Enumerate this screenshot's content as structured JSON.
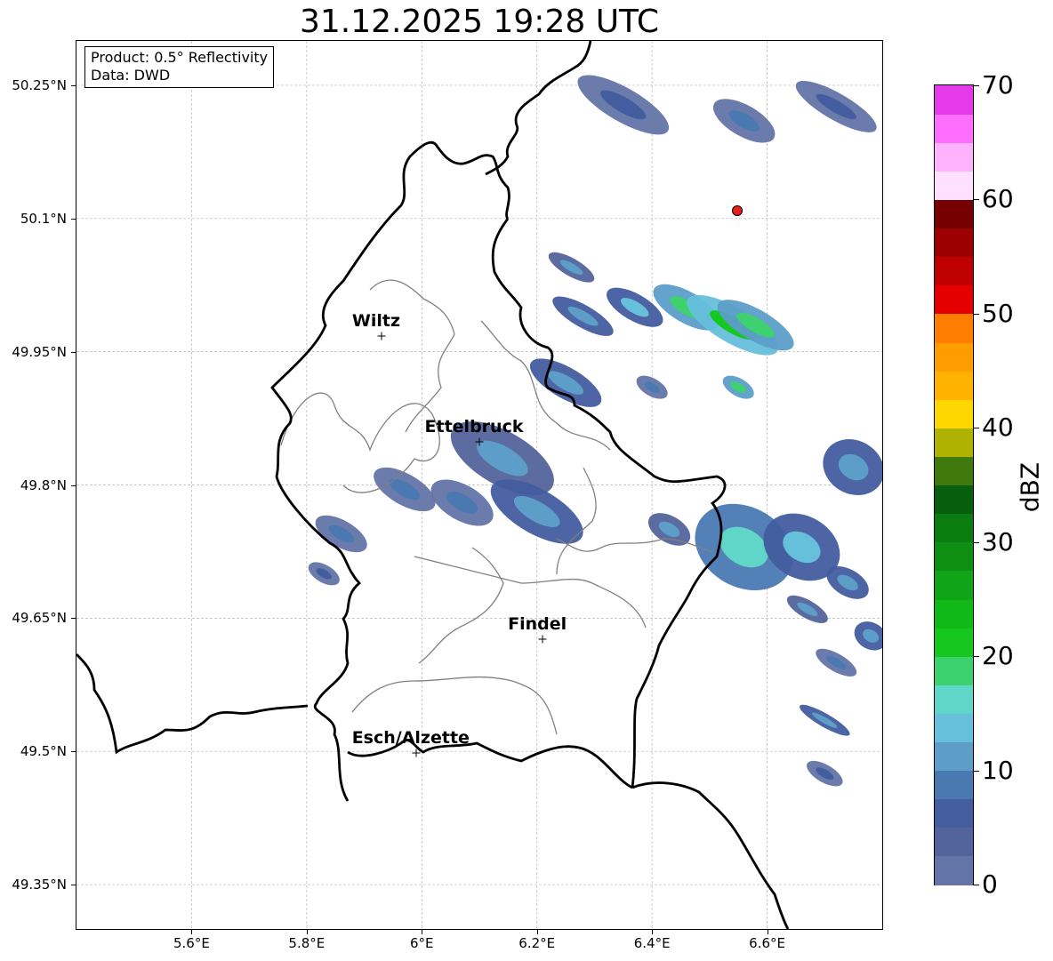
{
  "title": "31.12.2025 19:28 UTC",
  "info_box": {
    "line1": "Product: 0.5° Reflectivity",
    "line2": "Data: DWD"
  },
  "map": {
    "lon_range": [
      5.4,
      6.8
    ],
    "lat_range": [
      49.3,
      50.3
    ],
    "x_ticks": [
      {
        "value": 5.6,
        "label": "5.6°E"
      },
      {
        "value": 5.8,
        "label": "5.8°E"
      },
      {
        "value": 6.0,
        "label": "6°E"
      },
      {
        "value": 6.2,
        "label": "6.2°E"
      },
      {
        "value": 6.4,
        "label": "6.4°E"
      },
      {
        "value": 6.6,
        "label": "6.6°E"
      }
    ],
    "y_ticks": [
      {
        "value": 49.35,
        "label": "49.35°N"
      },
      {
        "value": 49.5,
        "label": "49.5°N"
      },
      {
        "value": 49.65,
        "label": "49.65°N"
      },
      {
        "value": 49.8,
        "label": "49.8°N"
      },
      {
        "value": 49.95,
        "label": "49.95°N"
      },
      {
        "value": 50.1,
        "label": "50.1°N"
      },
      {
        "value": 50.25,
        "label": "50.25°N"
      }
    ],
    "grid": true,
    "cities": [
      {
        "name": "Wiltz",
        "lon": 5.93,
        "lat": 49.968
      },
      {
        "name": "Ettelbruck",
        "lon": 6.1,
        "lat": 49.849
      },
      {
        "name": "Findel",
        "lon": 6.21,
        "lat": 49.626
      },
      {
        "name": "Esch/Alzette",
        "lon": 5.99,
        "lat": 49.498
      }
    ],
    "radar_site": {
      "lon": 6.548,
      "lat": 50.109,
      "color": "#e8201c"
    },
    "border_color": "#000000",
    "canton_color": "#808080",
    "echo_cells": [
      {
        "lon": 6.35,
        "lat": 50.228,
        "len": 0.18,
        "wid": 0.038,
        "dbz": 6
      },
      {
        "lon": 6.56,
        "lat": 50.21,
        "len": 0.12,
        "wid": 0.035,
        "dbz": 8
      },
      {
        "lon": 6.72,
        "lat": 50.226,
        "len": 0.16,
        "wid": 0.03,
        "dbz": 6
      },
      {
        "lon": 6.26,
        "lat": 50.045,
        "len": 0.09,
        "wid": 0.02,
        "dbz": 10
      },
      {
        "lon": 6.28,
        "lat": 49.99,
        "len": 0.12,
        "wid": 0.025,
        "dbz": 12
      },
      {
        "lon": 6.37,
        "lat": 50.0,
        "len": 0.11,
        "wid": 0.03,
        "dbz": 13
      },
      {
        "lon": 6.46,
        "lat": 50.0,
        "len": 0.13,
        "wid": 0.035,
        "dbz": 18
      },
      {
        "lon": 6.54,
        "lat": 49.98,
        "len": 0.18,
        "wid": 0.04,
        "dbz": 20
      },
      {
        "lon": 6.58,
        "lat": 49.98,
        "len": 0.15,
        "wid": 0.035,
        "dbz": 18
      },
      {
        "lon": 6.25,
        "lat": 49.915,
        "len": 0.14,
        "wid": 0.035,
        "dbz": 12
      },
      {
        "lon": 6.4,
        "lat": 49.91,
        "len": 0.06,
        "wid": 0.02,
        "dbz": 8
      },
      {
        "lon": 6.55,
        "lat": 49.91,
        "len": 0.06,
        "wid": 0.02,
        "dbz": 18
      },
      {
        "lon": 6.75,
        "lat": 49.82,
        "len": 0.11,
        "wid": 0.06,
        "dbz": 12
      },
      {
        "lon": 6.14,
        "lat": 49.83,
        "len": 0.2,
        "wid": 0.06,
        "dbz": 10
      },
      {
        "lon": 6.2,
        "lat": 49.77,
        "len": 0.18,
        "wid": 0.05,
        "dbz": 12
      },
      {
        "lon": 6.07,
        "lat": 49.78,
        "len": 0.12,
        "wid": 0.04,
        "dbz": 8
      },
      {
        "lon": 5.97,
        "lat": 49.795,
        "len": 0.12,
        "wid": 0.035,
        "dbz": 8
      },
      {
        "lon": 5.86,
        "lat": 49.745,
        "len": 0.1,
        "wid": 0.03,
        "dbz": 8
      },
      {
        "lon": 5.83,
        "lat": 49.7,
        "len": 0.06,
        "wid": 0.02,
        "dbz": 6
      },
      {
        "lon": 6.43,
        "lat": 49.75,
        "len": 0.08,
        "wid": 0.03,
        "dbz": 10
      },
      {
        "lon": 6.56,
        "lat": 49.73,
        "len": 0.18,
        "wid": 0.09,
        "dbz": 15
      },
      {
        "lon": 6.66,
        "lat": 49.73,
        "len": 0.14,
        "wid": 0.07,
        "dbz": 13
      },
      {
        "lon": 6.74,
        "lat": 49.69,
        "len": 0.08,
        "wid": 0.03,
        "dbz": 12
      },
      {
        "lon": 6.67,
        "lat": 49.66,
        "len": 0.08,
        "wid": 0.02,
        "dbz": 10
      },
      {
        "lon": 6.72,
        "lat": 49.6,
        "len": 0.08,
        "wid": 0.02,
        "dbz": 8
      },
      {
        "lon": 6.78,
        "lat": 49.63,
        "len": 0.06,
        "wid": 0.03,
        "dbz": 12
      },
      {
        "lon": 6.7,
        "lat": 49.535,
        "len": 0.1,
        "wid": 0.015,
        "dbz": 12
      },
      {
        "lon": 6.7,
        "lat": 49.475,
        "len": 0.07,
        "wid": 0.02,
        "dbz": 6
      }
    ]
  },
  "colorbar": {
    "label": "dBZ",
    "min": 0,
    "max": 70,
    "ticks": [
      {
        "value": 0,
        "label": "0"
      },
      {
        "value": 10,
        "label": "10"
      },
      {
        "value": 20,
        "label": "20"
      },
      {
        "value": 30,
        "label": "30"
      },
      {
        "value": 40,
        "label": "40"
      },
      {
        "value": 50,
        "label": "50"
      },
      {
        "value": 60,
        "label": "60"
      },
      {
        "value": 70,
        "label": "70"
      }
    ],
    "colors": [
      "#6374a8",
      "#53649c",
      "#435d9f",
      "#4a79b2",
      "#5c9ec8",
      "#66bfdb",
      "#5fd6c7",
      "#3dd26e",
      "#15c71e",
      "#10b818",
      "#10a516",
      "#0f8e14",
      "#0a7c10",
      "#075e0d",
      "#417a0c",
      "#afb200",
      "#ffd600",
      "#ffb300",
      "#ff9c00",
      "#ff7e00",
      "#e50000",
      "#bf0000",
      "#9d0000",
      "#760000",
      "#ffe0ff",
      "#ffb3ff",
      "#ff6eff",
      "#e53ae9"
    ]
  }
}
